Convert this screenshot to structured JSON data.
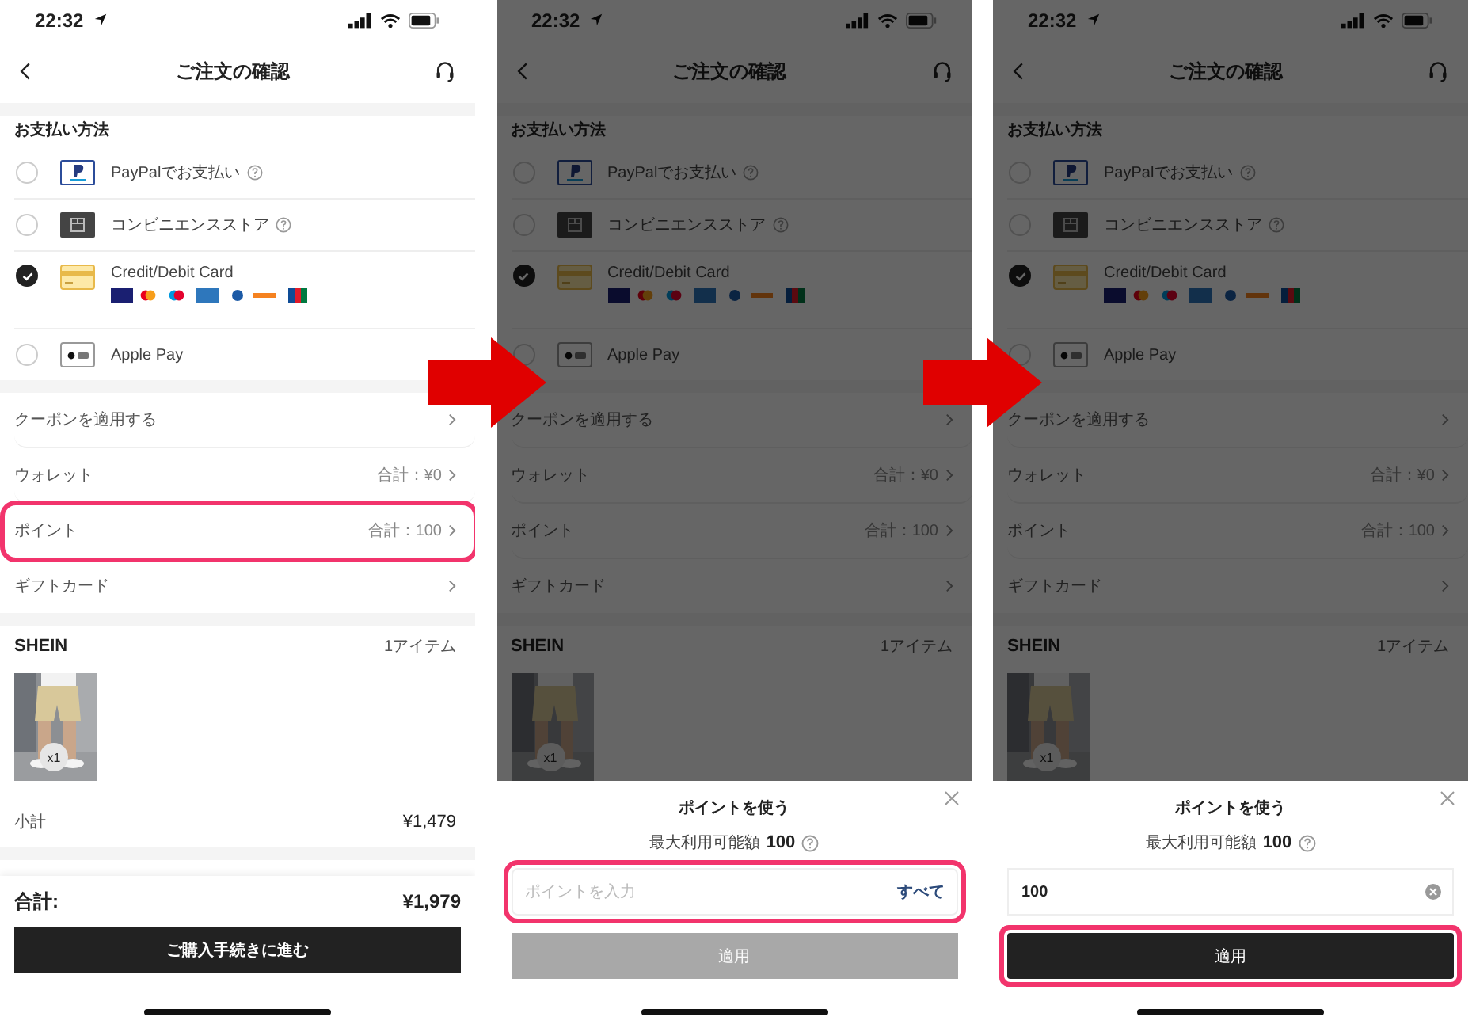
{
  "screens": [
    {
      "dimmed": false,
      "status": {
        "time": "22:32"
      },
      "header": {
        "title": "ご注文の確認"
      },
      "payment": {
        "heading": "お支払い方法",
        "methods": [
          {
            "kind": "paypal",
            "label": "PayPalでお支払い",
            "help": true,
            "selected": false
          },
          {
            "kind": "store",
            "label": "コンビニエンスストア",
            "help": true,
            "selected": false
          },
          {
            "kind": "card",
            "label": "Credit/Debit Card",
            "help": false,
            "selected": true
          },
          {
            "kind": "applepay",
            "label": "Apple Pay",
            "help": false,
            "selected": false
          }
        ]
      },
      "options": [
        {
          "label": "クーポンを適用する",
          "highlighted": false
        },
        {
          "label": "ウォレット",
          "value": "合計：¥0",
          "highlighted": false
        },
        {
          "label": "ポイント",
          "value": "合計：100",
          "highlighted": true
        },
        {
          "label": "ギフトカード",
          "highlighted": false
        }
      ],
      "store": {
        "name": "SHEIN",
        "count": "1アイテム",
        "quantity": "x1"
      },
      "subtotal": {
        "label": "小計",
        "value": "¥1,479"
      },
      "total": {
        "label": "合計:",
        "value": "¥1,979"
      },
      "checkout_button": "ご購入手続きに進む"
    },
    {
      "dimmed": true,
      "status": {
        "time": "22:32"
      },
      "header": {
        "title": "ご注文の確認"
      },
      "payment": {
        "heading": "お支払い方法",
        "methods": [
          {
            "kind": "paypal",
            "label": "PayPalでお支払い",
            "help": true,
            "selected": false
          },
          {
            "kind": "store",
            "label": "コンビニエンスストア",
            "help": true,
            "selected": false
          },
          {
            "kind": "card",
            "label": "Credit/Debit Card",
            "help": false,
            "selected": true
          },
          {
            "kind": "applepay",
            "label": "Apple Pay",
            "help": false,
            "selected": false
          }
        ]
      },
      "options": [
        {
          "label": "クーポンを適用する",
          "highlighted": false
        },
        {
          "label": "ウォレット",
          "value": "合計：¥0",
          "highlighted": false
        },
        {
          "label": "ポイント",
          "value": "合計：100",
          "highlighted": false
        },
        {
          "label": "ギフトカード",
          "highlighted": false
        }
      ],
      "store": {
        "name": "SHEIN",
        "count": "1アイテム",
        "quantity": "x1"
      },
      "sheet": {
        "title": "ポイントを使う",
        "max_label": "最大利用可能額",
        "max_value": "100",
        "field": {
          "placeholder": "ポイントを入力",
          "all_link": "すべて",
          "highlighted": true
        },
        "apply_button": {
          "label": "適用",
          "disabled": true,
          "highlighted": false
        }
      }
    },
    {
      "dimmed": true,
      "status": {
        "time": "22:32"
      },
      "header": {
        "title": "ご注文の確認"
      },
      "payment": {
        "heading": "お支払い方法",
        "methods": [
          {
            "kind": "paypal",
            "label": "PayPalでお支払い",
            "help": true,
            "selected": false
          },
          {
            "kind": "store",
            "label": "コンビニエンスストア",
            "help": true,
            "selected": false
          },
          {
            "kind": "card",
            "label": "Credit/Debit Card",
            "help": false,
            "selected": true
          },
          {
            "kind": "applepay",
            "label": "Apple Pay",
            "help": false,
            "selected": false
          }
        ]
      },
      "options": [
        {
          "label": "クーポンを適用する",
          "highlighted": false
        },
        {
          "label": "ウォレット",
          "value": "合計：¥0",
          "highlighted": false
        },
        {
          "label": "ポイント",
          "value": "合計：100",
          "highlighted": false
        },
        {
          "label": "ギフトカード",
          "highlighted": false
        }
      ],
      "store": {
        "name": "SHEIN",
        "count": "1アイテム",
        "quantity": "x1"
      },
      "sheet": {
        "title": "ポイントを使う",
        "max_label": "最大利用可能額",
        "max_value": "100",
        "field": {
          "value": "100",
          "highlighted": false
        },
        "apply_button": {
          "label": "適用",
          "disabled": false,
          "highlighted": true
        }
      }
    }
  ]
}
